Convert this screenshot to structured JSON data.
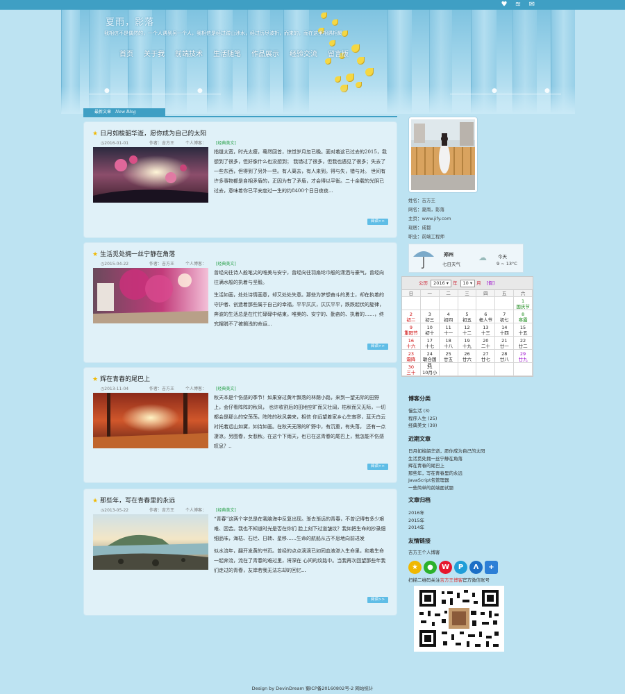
{
  "header": {
    "site_title": "夏雨，影落",
    "slogan": "我相信不是偶然的，一个人遇到另一个人，我相信是经过跋山涉水，经过历尽波折，而来的，而在这里相遇相聚",
    "icons": [
      "heart-icon",
      "rss-icon",
      "mail-icon"
    ]
  },
  "nav": [
    "首页",
    "关于我",
    "前端技术",
    "生活随笔",
    "作品展示",
    "经验交流",
    "留言版"
  ],
  "latest": {
    "label": "最新文章",
    "label_en": "New Blog"
  },
  "posts": [
    {
      "title": "日月如梭韶华逝，愿你成为自己的太阳",
      "date": "2016-01-01",
      "author": "作者：吉方王",
      "category": "个人博客：",
      "tag": "[经典美文]",
      "body": "指缝太宽，时光太瘦，蓦然回首，惊觉岁月忽已晚。面对着这已过去的2015，我想到了很多，但好像什么也没想到； 我错过了很多，但我也遇见了很多；失去了一些东西，但得到了另外一些。有人离去，有人来到。得与失，错与对。 世间有许多事物都是自相矛盾的，正因为有了矛盾，才会得以平衡。二十余载的光阴已过去，意味着你已平安度过一生的约8400个日日夜夜...",
      "more": "阅读>>"
    },
    {
      "title": "生活觅处拥一丝宁静在角落",
      "date": "2015-04-22",
      "author": "作者：吉方王",
      "category": "个人博客：",
      "tag": "[经典美文]",
      "body1": "曾经向往诗人般笔尖的唯美与安宁，曾经向往羽扇纶巾般的潇洒与豪气，曾经向往满水般的执着与坚毅。",
      "body2": "生活如画，处处诗情画意，却又处处失意。那些为梦想奋斗的勇士，却在执着的守护者、创造着那些属于自己的幸福。平平仄仄，仄仄平平，跌跌起伏的旋律， 奔波的生活总是在忙忙碌碌中结束。唯美的、安宁的、勤奋的、执着的……，终究摆脱不了被搁浅的命运...",
      "more": "阅读>>"
    },
    {
      "title": "辉在青春的尾巴上",
      "date": "2013-11-04",
      "author": "作者：吉方王",
      "category": "个人博客：",
      "tag": "[经典美文]",
      "body": "秋天本是个伤感的季节！如果穿过黄叶飘落的林荫小路，来到一望无际的田野上，会仔看阵阵的秋风， 也许收割后的田地空旷而又壮阔，枯秋而又无际，一切都会是那么的空荡荡，阵阵的秋风袭来，相信 你远望着家乡心生寂寥，蓝天白云衬托着远山如黛，如诗如画。在秋天无限的旷野中，有沉重，有失落， 还有一点凄凉。另图春，女悲秋。在这个下雨天，也已在这青春的尾巴上，我怎能不伤感叹息？..",
      "more": "阅读>>"
    },
    {
      "title": "那些年，写在青春里的永远",
      "date": "2013-05-22",
      "author": "作者：吉方王",
      "category": "个人博客：",
      "tag": "[经典美文]",
      "body1": "“青春”这两个字总是在我脑海中反复出现。渐去渐远的青春，不曾记得有多少艰难、困苦。我也不知道时光是否在你们 脸上刻下过道皱纹？我如把生命的抄录细细品味，海枯、石烂、日转、星移……生命的航船从古不息地向前进发",
      "body2": "似水流年，翻开发黄的书页。曾经的点点滴滴已如同血液渗入生命里，和着生命一起奔流，流在了青春的难过里，将深在 心间的纹路中。当我再次回望那些年我们走过的青春，友岸若我无法忘却的回忆...",
      "more": "阅读>>"
    }
  ],
  "profile": {
    "name": "姓名：吉方王",
    "nickname": "网名：夏雨，影落",
    "homepage": "主页：www.jify.com",
    "location": "现居：成都",
    "job": "职业：前端工程师"
  },
  "weather": {
    "city": "郑州",
    "days": "七日天气",
    "today": "今天",
    "temp": "9 ~ 13°C"
  },
  "calendar": {
    "label_gl": "公历",
    "year": "2016",
    "label_year": "年",
    "month": "10",
    "label_month": "月",
    "holiday": "[假]",
    "weekdays": [
      "日",
      "一",
      "二",
      "三",
      "四",
      "五",
      "六"
    ],
    "cells": [
      {
        "d": "",
        "l": ""
      },
      {
        "d": "",
        "l": ""
      },
      {
        "d": "",
        "l": ""
      },
      {
        "d": "",
        "l": ""
      },
      {
        "d": "",
        "l": ""
      },
      {
        "d": "",
        "l": ""
      },
      {
        "d": "1",
        "l": "国庆节",
        "c": "green"
      },
      {
        "d": "2",
        "l": "初二",
        "c": "red"
      },
      {
        "d": "3",
        "l": "初三"
      },
      {
        "d": "4",
        "l": "初四"
      },
      {
        "d": "5",
        "l": "初五"
      },
      {
        "d": "6",
        "l": "老人节"
      },
      {
        "d": "7",
        "l": "初七"
      },
      {
        "d": "8",
        "l": "寒露",
        "c": "green"
      },
      {
        "d": "9",
        "l": "重阳节",
        "c": "red"
      },
      {
        "d": "10",
        "l": "初十"
      },
      {
        "d": "11",
        "l": "十一"
      },
      {
        "d": "12",
        "l": "十二"
      },
      {
        "d": "13",
        "l": "十三"
      },
      {
        "d": "14",
        "l": "十四"
      },
      {
        "d": "15",
        "l": "十五"
      },
      {
        "d": "16",
        "l": "十六",
        "c": "red"
      },
      {
        "d": "17",
        "l": "十七"
      },
      {
        "d": "18",
        "l": "十八"
      },
      {
        "d": "19",
        "l": "十九"
      },
      {
        "d": "20",
        "l": "二十"
      },
      {
        "d": "21",
        "l": "廿一"
      },
      {
        "d": "22",
        "l": "廿二"
      },
      {
        "d": "23",
        "l": "霜降",
        "c": "red"
      },
      {
        "d": "24",
        "l": "联合国日"
      },
      {
        "d": "25",
        "l": "廿五"
      },
      {
        "d": "26",
        "l": "廿六"
      },
      {
        "d": "27",
        "l": "廿七"
      },
      {
        "d": "28",
        "l": "廿八"
      },
      {
        "d": "29",
        "l": "廿九",
        "c": "purple"
      },
      {
        "d": "30",
        "l": "三十",
        "c": "red"
      },
      {
        "d": "31",
        "l": "10月小"
      },
      {
        "d": "",
        "l": ""
      },
      {
        "d": "",
        "l": ""
      },
      {
        "d": "",
        "l": ""
      },
      {
        "d": "",
        "l": ""
      },
      {
        "d": "",
        "l": ""
      }
    ]
  },
  "categories": {
    "title": "博客分类",
    "items": [
      "慢生活 (3)",
      "程序人生 (25)",
      "经典美文 (39)"
    ]
  },
  "recent": {
    "title": "近期文章",
    "items": [
      "日月如梭韶华逝，愿你成为自己的太阳",
      "生活觅处拥一丝宁静在角落",
      "辉在青春的尾巴上",
      "那些年，写在青春里的永远",
      "JavaScript包管理器",
      "一些简单的前端面试题"
    ]
  },
  "archive": {
    "title": "文章归档",
    "items": [
      "2016年",
      "2015年",
      "2014年"
    ]
  },
  "links": {
    "title": "友情链接",
    "items": [
      "吉方王个人博客"
    ]
  },
  "wechat": {
    "prefix": "扫描二维码关注",
    "name": "吉方王博客",
    "suffix": "官方微信账号"
  },
  "footer": "Design by DevinDream 蜀ICP备20160802号-2 网站统计",
  "colors": {
    "topbar": "#3f9fc4",
    "page_bg": "#bde3f2",
    "post_bg": "#e0f1f8",
    "tag_green": "#29a14a",
    "more_btn": "#5fbde6"
  }
}
